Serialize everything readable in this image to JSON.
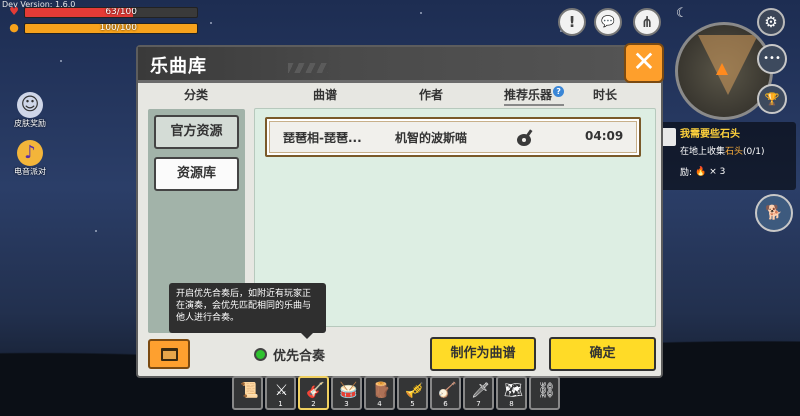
{
  "hud": {
    "dev_version": "Dev Version: 1.6.0",
    "health": {
      "text": "63/100",
      "value": 63,
      "max": 100,
      "color": "#e43b36"
    },
    "hunger": {
      "text": "100/100",
      "value": 100,
      "max": 100,
      "color": "#f7a21c"
    },
    "skin_reward_label": "皮肤奖励",
    "music_party_label": "电音派对",
    "top_buttons": {
      "alert": "!",
      "chat": "💬",
      "share": "⋔",
      "settings": "⚙"
    },
    "minimap_more": "•••",
    "trophy": "🏆"
  },
  "quest": {
    "title": "我需要些石头",
    "desc_prefix": "在地上收集",
    "desc_highlight": "石头",
    "desc_suffix": "(0/1)",
    "reward_prefix": "励:",
    "reward_count": "× 3"
  },
  "dialog": {
    "title": "乐曲库",
    "close": "✕",
    "columns": {
      "category": "分类",
      "score": "曲谱",
      "author": "作者",
      "instrument": "推荐乐器",
      "help": "?",
      "duration": "时长"
    },
    "categories": [
      {
        "label": "官方资源",
        "active": true
      },
      {
        "label": "资源库",
        "active": false
      }
    ],
    "rows": [
      {
        "title": "琵琶相-琵琶...",
        "author": "机智的波斯喵",
        "instrument_icon": "lute-icon",
        "duration": "04:09"
      }
    ],
    "tooltip": "开启优先合奏后，如附近有玩家正在演奏，会优先匹配相同的乐曲与他人进行合奏。",
    "ensemble_label": "优先合奏",
    "make_score_button": "制作为曲谱",
    "confirm_button": "确定"
  },
  "hotbar": {
    "slots": [
      {
        "num": "",
        "icon": "📜"
      },
      {
        "num": "1",
        "icon": "⚔"
      },
      {
        "num": "2",
        "icon": "🎸",
        "selected": true
      },
      {
        "num": "3",
        "icon": "🥁"
      },
      {
        "num": "4",
        "icon": "🪵"
      },
      {
        "num": "5",
        "icon": "🎺"
      },
      {
        "num": "6",
        "icon": "🪕"
      },
      {
        "num": "7",
        "icon": "🗡"
      },
      {
        "num": "8",
        "icon": "🗺"
      },
      {
        "num": "",
        "icon": "⛓"
      }
    ]
  },
  "colors": {
    "accent_orange": "#fe9f2c",
    "confirm_yellow": "#ffdb27",
    "ensemble_green": "#2fc22f"
  }
}
